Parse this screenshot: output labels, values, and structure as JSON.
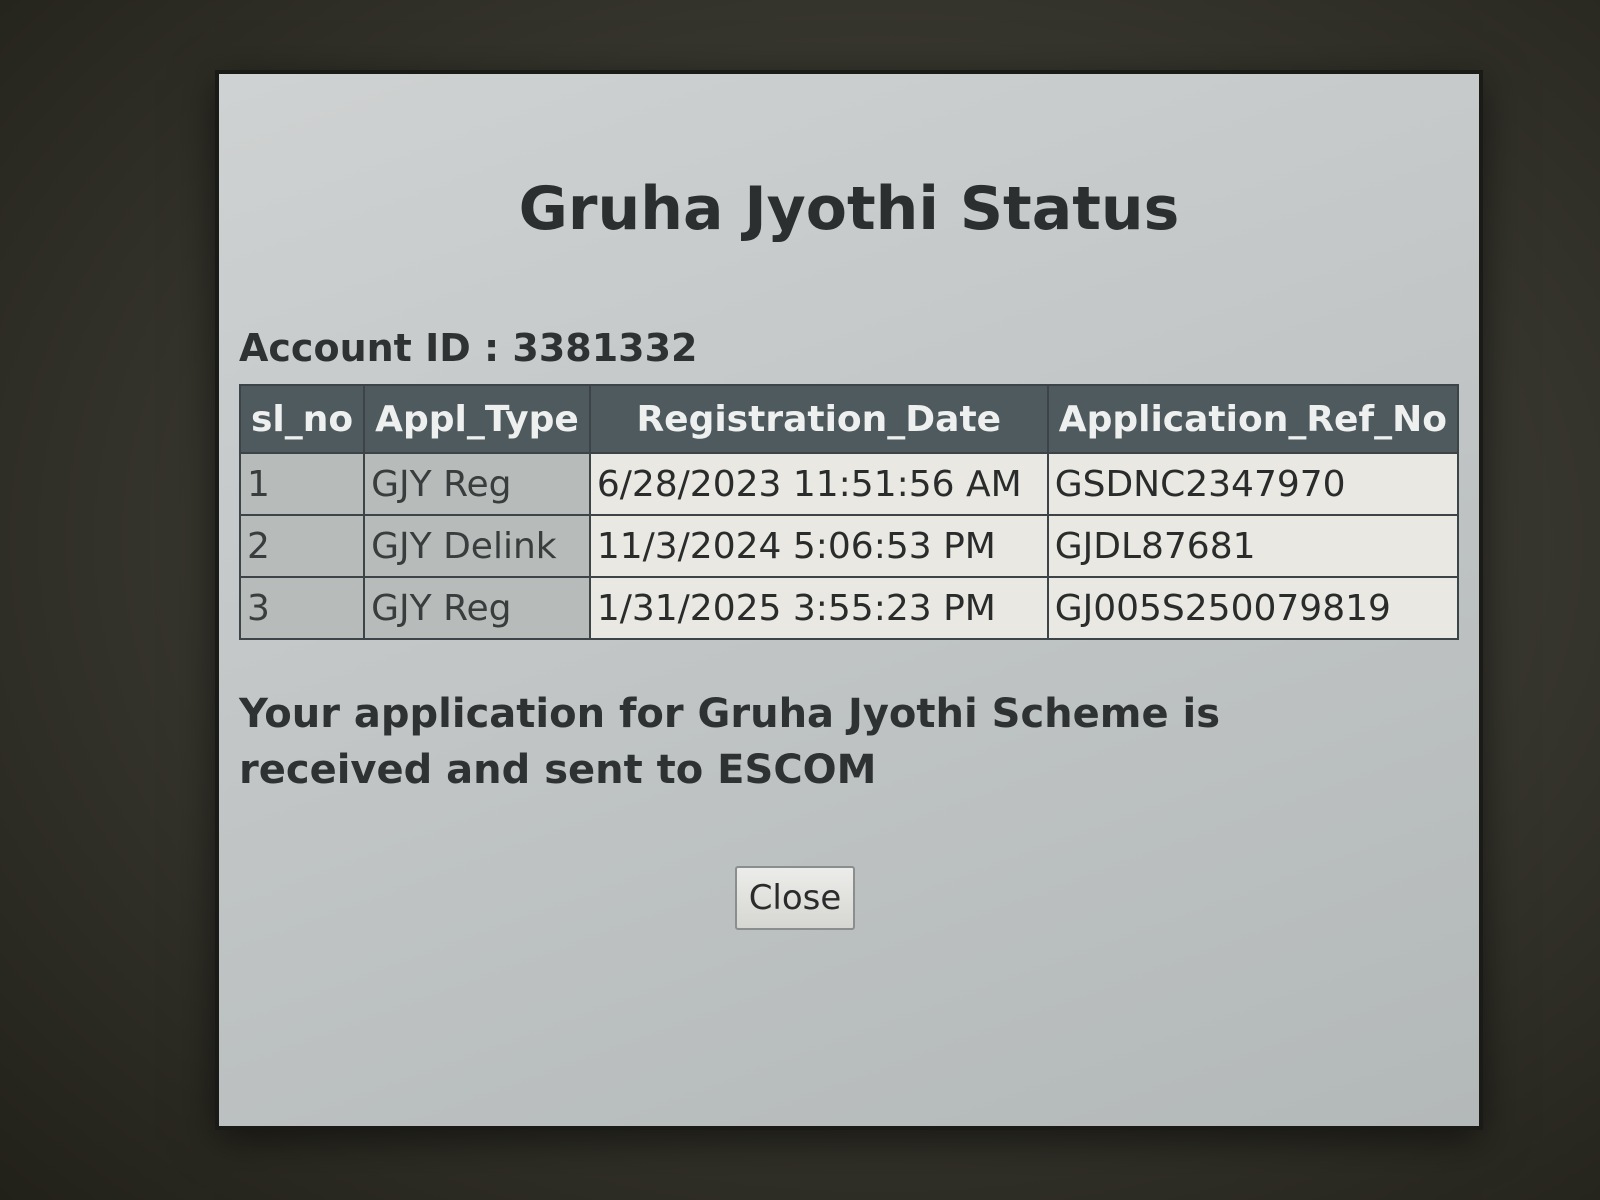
{
  "dialog": {
    "title": "Gruha Jyothi Status",
    "account_label": "Account ID : 3381332",
    "table": {
      "headers": [
        "sl_no",
        "Appl_Type",
        "Registration_Date",
        "Application_Ref_No"
      ],
      "rows": [
        [
          "1",
          "GJY Reg",
          "6/28/2023 11:51:56 AM",
          "GSDNC2347970"
        ],
        [
          "2",
          "GJY Delink",
          "11/3/2024 5:06:53 PM",
          "GJDL87681"
        ],
        [
          "3",
          "GJY Reg",
          "1/31/2025 3:55:23 PM",
          "GJ005S250079819"
        ]
      ]
    },
    "message": "Your application for Gruha Jyothi Scheme is received and sent to ESCOM",
    "close_label": "Close"
  }
}
